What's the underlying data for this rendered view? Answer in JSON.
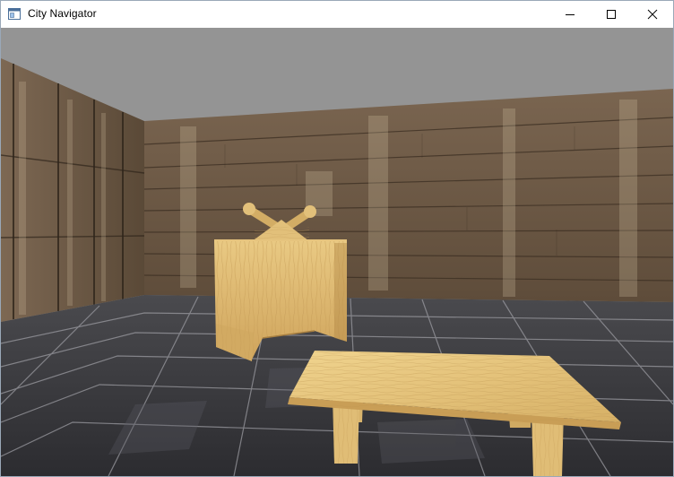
{
  "window": {
    "title": "City Navigator",
    "controls": [
      {
        "name": "minimize-button",
        "icon": "minimize-icon"
      },
      {
        "name": "maximize-button",
        "icon": "maximize-icon"
      },
      {
        "name": "close-button",
        "icon": "close-icon"
      }
    ]
  },
  "scene": {
    "colors": {
      "sky": "#949494",
      "wood_wall": "#6e5a45",
      "floor_tile": "#3a3a3c",
      "grout": "#a8a8ad",
      "light_wood": "#e2c07a"
    },
    "objects": [
      "back-wall",
      "left-wall",
      "tiled-floor",
      "cabinet",
      "coffee-table"
    ]
  }
}
